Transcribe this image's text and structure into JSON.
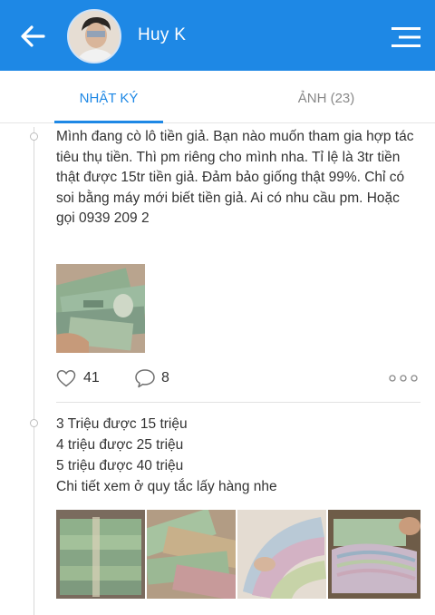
{
  "header": {
    "username": "Huy K",
    "colors": {
      "bar": "#1e88e5",
      "text": "#ffffff"
    }
  },
  "tabs": [
    {
      "label": "NHẬT KÝ",
      "active": true
    },
    {
      "label": "ẢNH (23)",
      "active": false
    }
  ],
  "posts": [
    {
      "text": "Mình đang cò lô tiền giả. Bạn nào muốn tham gia hợp tác tiêu thụ tiền. Thì pm riêng cho mình nha. Tỉ lệ là 3tr tiền thật được 15tr tiền giả. Đảm bảo giống thật 99%. Chỉ có soi bằng máy mới biết tiền giả. Ai có nhu cầu pm. Hoặc gọi 0939 209 2",
      "likes": "41",
      "comments": "8"
    },
    {
      "lines": [
        "3 Triệu được 15 triệu",
        "4 triệu được 25 triệu",
        "5 triệu được 40 triệu",
        "Chi tiết xem ở quy tắc lấy hàng nhe"
      ]
    }
  ],
  "icons": {
    "back": "back-arrow-icon",
    "menu": "menu-icon",
    "like": "heart-icon",
    "comment": "comment-icon",
    "more": "more-options-icon"
  }
}
